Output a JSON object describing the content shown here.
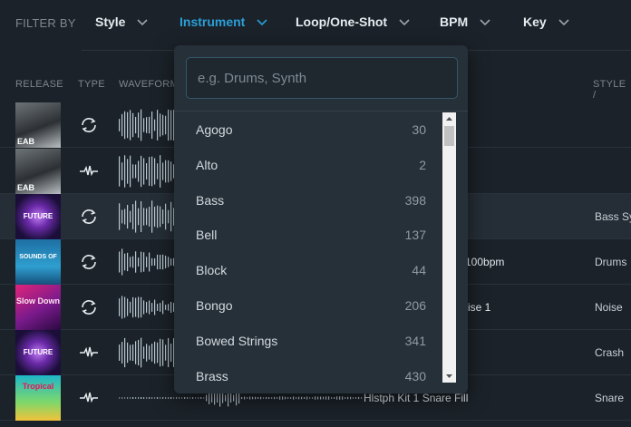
{
  "filter_bar": {
    "label": "FILTER BY",
    "filters": [
      {
        "label": "Style",
        "active": false
      },
      {
        "label": "Instrument",
        "active": true
      },
      {
        "label": "Loop/One-Shot",
        "active": false
      },
      {
        "label": "BPM",
        "active": false
      },
      {
        "label": "Key",
        "active": false
      }
    ]
  },
  "table": {
    "headers": {
      "release": "RELEASE",
      "type": "TYPE",
      "waveform": "WAVEFORM",
      "style": "STYLE /"
    },
    "rows": [
      {
        "art_text": "EAB",
        "type": "loop",
        "name": "",
        "style": ""
      },
      {
        "art_text": "EAB",
        "type": "one-shot",
        "name": "",
        "style": ""
      },
      {
        "art_text": "FUTURE",
        "type": "loop",
        "name": "",
        "style": "Bass Sy"
      },
      {
        "art_text": "SOUNDS OF",
        "type": "loop",
        "name": "100bpm",
        "style": "Drums"
      },
      {
        "art_text": "Slow Down",
        "type": "loop",
        "name": "ise 1",
        "style": "Noise"
      },
      {
        "art_text": "FUTURE",
        "type": "one-shot",
        "name": "",
        "style": "Crash"
      },
      {
        "art_text": "Tropical",
        "type": "one-shot",
        "name": "Hlstph Kit 1 Snare Fill",
        "style": "Snare"
      }
    ]
  },
  "dropdown": {
    "search_placeholder": "e.g. Drums, Synth",
    "options": [
      {
        "label": "Agogo",
        "count": "30"
      },
      {
        "label": "Alto",
        "count": "2"
      },
      {
        "label": "Bass",
        "count": "398"
      },
      {
        "label": "Bell",
        "count": "137"
      },
      {
        "label": "Block",
        "count": "44"
      },
      {
        "label": "Bongo",
        "count": "206"
      },
      {
        "label": "Bowed Strings",
        "count": "341"
      },
      {
        "label": "Brass",
        "count": "430"
      }
    ]
  },
  "colors": {
    "accent": "#2a9fd8",
    "background": "#1b2229",
    "dropdown_bg": "#263038"
  }
}
